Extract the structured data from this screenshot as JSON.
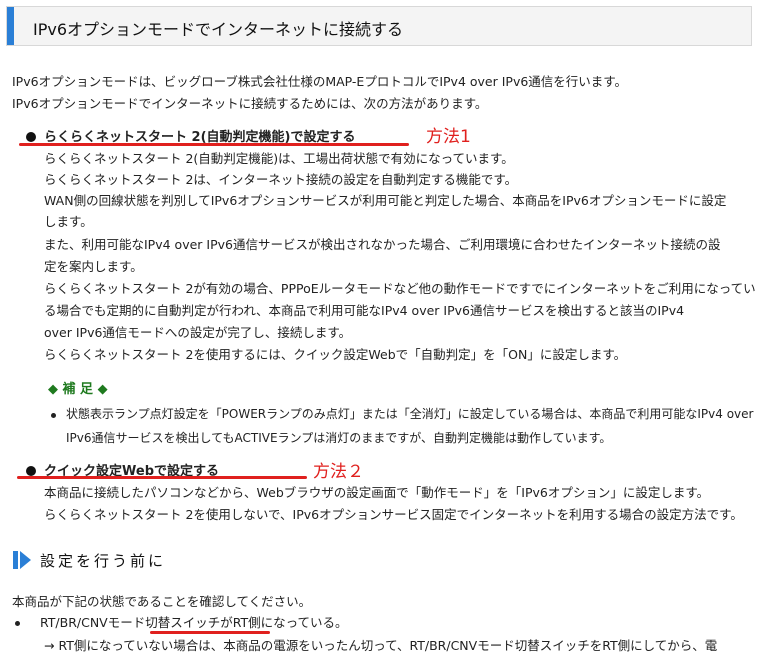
{
  "header": {
    "title": "IPv6オプションモードでインターネットに接続する"
  },
  "intro": [
    "IPv6オプションモードは、ビッグローブ株式会社仕様のMAP-EプロトコルでIPv4 over IPv6通信を行います。",
    "IPv6オプションモードでインターネットに接続するためには、次の方法があります。"
  ],
  "method1": {
    "heading": "らくらくネットスタート 2(自動判定機能)で設定する",
    "annotation": "方法1",
    "lines": [
      "らくらくネットスタート 2(自動判定機能)は、工場出荷状態で有効になっています。",
      "らくらくネットスタート 2は、インターネット接続の設定を自動判定する機能です。",
      "WAN側の回線状態を判別してIPv6オプションサービスが利用可能と判定した場合、本商品をIPv6オプションモードに設定",
      "します。",
      "また、利用可能なIPv4 over IPv6通信サービスが検出されなかった場合、ご利用環境に合わせたインターネット接続の設",
      "定を案内します。",
      "らくらくネットスタート 2が有効の場合、PPPoEルータモードなど他の動作モードですでにインターネットをご利用になってい",
      "る場合でも定期的に自動判定が行われ、本商品で利用可能なIPv4 over IPv6通信サービスを検出すると該当のIPv4",
      "over IPv6通信モードへの設定が完了し、接続します。",
      "らくらくネットスタート 2を使用するには、クイック設定Webで「自動判定」を「ON」に設定します。"
    ]
  },
  "note": {
    "heading": "◆ 補 足 ◆",
    "lines": [
      "状態表示ランプ点灯設定を「POWERランプのみ点灯」または「全消灯」に設定している場合は、本商品で利用可能なIPv4 over",
      "IPv6通信サービスを検出してもACTIVEランプは消灯のままですが、自動判定機能は動作しています。"
    ]
  },
  "method2": {
    "heading": "クイック設定Webで設定する",
    "annotation": "方法２",
    "lines": [
      "本商品に接続したパソコンなどから、Webブラウザの設定画面で「動作モード」を「IPv6オプション」に設定します。",
      "らくらくネットスタート 2を使用しないで、IPv6オプションサービス固定でインターネットを利用する場合の設定方法です。"
    ]
  },
  "before": {
    "heading": "設定を行う前に",
    "intro": "本商品が下記の状態であることを確認してください。",
    "item": "RT/BR/CNVモード切替スイッチがRT側になっている。",
    "sub": "→ RT側になっていない場合は、本商品の電源をいったん切って、RT/BR/CNVモード切替スイッチをRT側にしてから、電"
  },
  "colors": {
    "accent": "#2a7fd6",
    "annotation_red": "#e0201e",
    "note_green": "#1f7a1f"
  }
}
